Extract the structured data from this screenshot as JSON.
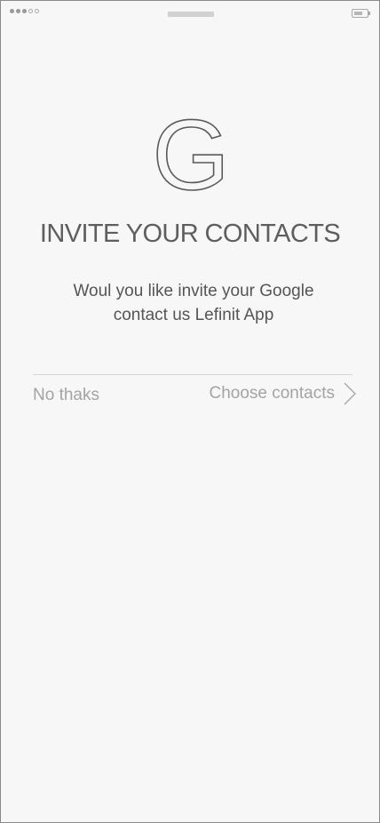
{
  "status_bar": {
    "signal_dots": [
      "filled",
      "filled",
      "filled",
      "empty",
      "empty"
    ],
    "battery_level_percent": 70
  },
  "invite": {
    "logo_icon": "google-g-icon",
    "logo_letter": "G",
    "title": "INVITE YOUR CONTACTS",
    "message_line1": "Woul you like invite your Google",
    "message_line2": "contact us Lefinit App"
  },
  "actions": {
    "decline_label": "No thaks",
    "accept_label": "Choose contacts",
    "accept_icon": "chevron-right-icon"
  },
  "colors": {
    "background": "#f7f7f7",
    "title": "#5e5e5e",
    "body_text": "#555555",
    "action_text": "#a4a4a4",
    "divider": "#d6d6d6"
  }
}
